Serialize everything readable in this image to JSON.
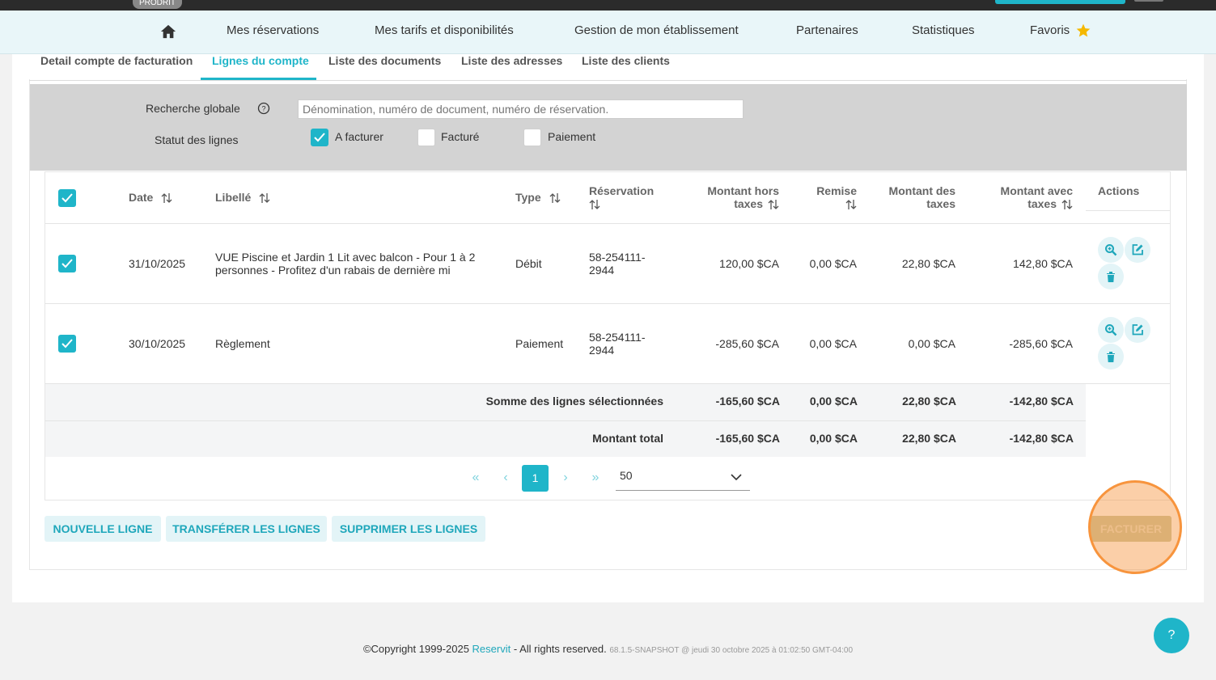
{
  "topbar": {
    "env_badge": "PRODRIT"
  },
  "nav": {
    "items": [
      "Mes réservations",
      "Mes tarifs et disponibilités",
      "Gestion de mon établissement",
      "Partenaires",
      "Statistiques",
      "Favoris"
    ]
  },
  "tabs": [
    "Detail compte de facturation",
    "Lignes du compte",
    "Liste des documents",
    "Liste des adresses",
    "Liste des clients"
  ],
  "active_tab": "Lignes du compte",
  "filters": {
    "search_label": "Recherche globale",
    "search_placeholder": "Dénomination, numéro de document, numéro de réservation.",
    "status_label": "Statut des lignes",
    "statuses": [
      {
        "label": "A facturer",
        "checked": true
      },
      {
        "label": "Facturé",
        "checked": false
      },
      {
        "label": "Paiement",
        "checked": false
      }
    ]
  },
  "table": {
    "headers": {
      "date": "Date",
      "libelle": "Libellé",
      "type": "Type",
      "reservation": "Réservation",
      "ht_1": "Montant hors",
      "ht_2": "taxes",
      "remise": "Remise",
      "taxes_1": "Montant des",
      "taxes_2": "taxes",
      "ttc_1": "Montant avec",
      "ttc_2": "taxes",
      "actions": "Actions"
    },
    "rows": [
      {
        "checked": true,
        "date": "31/10/2025",
        "libelle": "VUE Piscine et Jardin 1 Lit avec balcon - Pour 1 à 2 personnes - Profitez d'un rabais de dernière mi",
        "type": "Débit",
        "reservation_1": "58-254111-",
        "reservation_2": "2944",
        "ht": "120,00 $CA",
        "remise": "0,00 $CA",
        "taxes": "22,80 $CA",
        "ttc": "142,80 $CA"
      },
      {
        "checked": true,
        "date": "30/10/2025",
        "libelle": "Règlement",
        "type": "Paiement",
        "reservation_1": "58-254111-",
        "reservation_2": "2944",
        "ht": "-285,60 $CA",
        "remise": "0,00 $CA",
        "taxes": "0,00 $CA",
        "ttc": "-285,60 $CA"
      }
    ],
    "selected_sum": {
      "label": "Somme des lignes sélectionnées",
      "ht": "-165,60 $CA",
      "remise": "0,00 $CA",
      "taxes": "22,80 $CA",
      "ttc": "-142,80 $CA"
    },
    "total": {
      "label": "Montant total",
      "ht": "-165,60 $CA",
      "remise": "0,00 $CA",
      "taxes": "22,80 $CA",
      "ttc": "-142,80 $CA"
    }
  },
  "pagination": {
    "first": "«",
    "prev": "‹",
    "current": "1",
    "next": "›",
    "last": "»",
    "page_size": "50"
  },
  "buttons": {
    "new_line": "NOUVELLE LIGNE",
    "transfer": "TRANSFÉRER LES LIGNES",
    "delete": "SUPPRIMER LES LIGNES",
    "invoice": "FACTURER"
  },
  "footer": {
    "copyright": "©Copyright 1999-2025 ",
    "brand": "Reservit",
    "rights": " - All rights reserved. ",
    "version": "68.1.5-SNAPSHOT @ jeudi 30 octobre 2025 à 01:02:50 GMT-04:00"
  },
  "help_fab": "?",
  "colors": {
    "accent": "#1fb5c9",
    "highlight": "#f7943d"
  }
}
